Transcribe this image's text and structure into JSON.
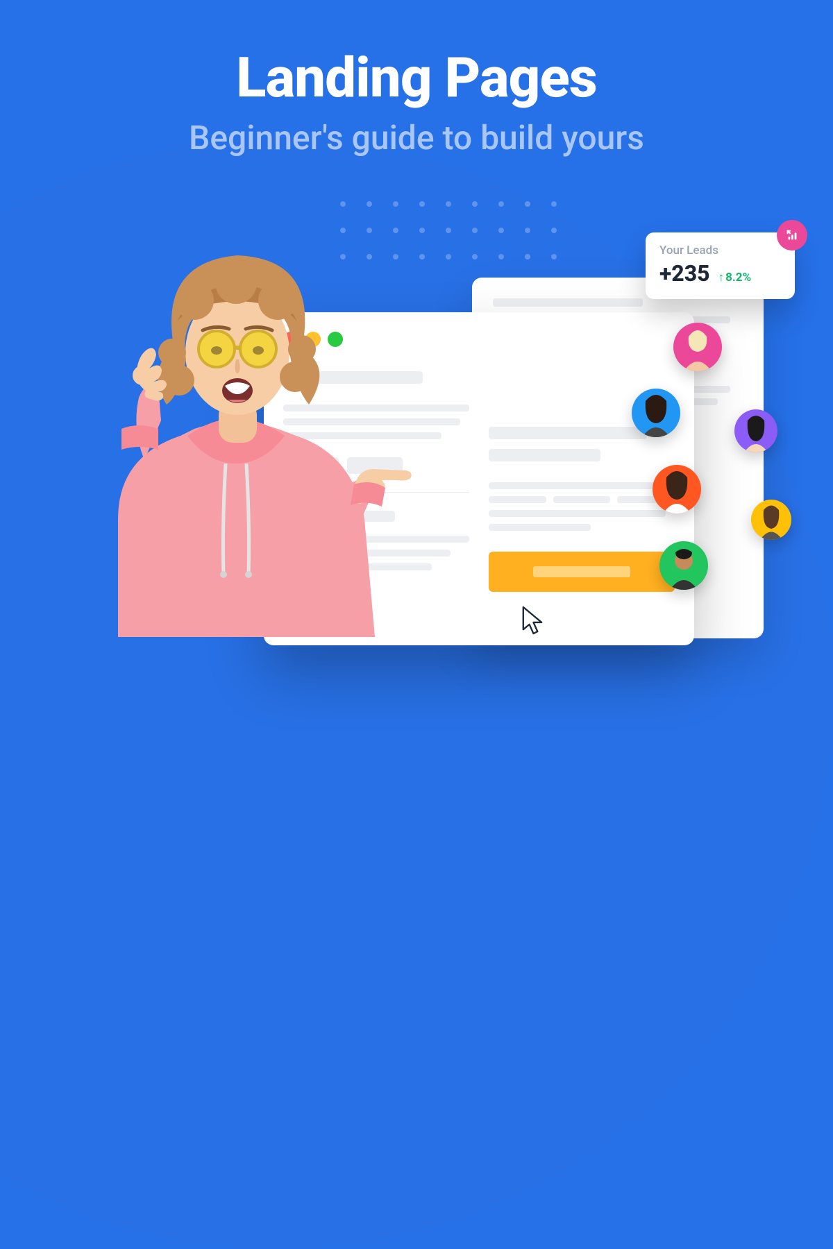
{
  "hero": {
    "title": "Landing Pages",
    "subtitle": "Beginner's guide to build yours"
  },
  "leads_card": {
    "label": "Your Leads",
    "value": "+235",
    "trend_arrow": "↑",
    "trend_percent": "8.2%"
  }
}
